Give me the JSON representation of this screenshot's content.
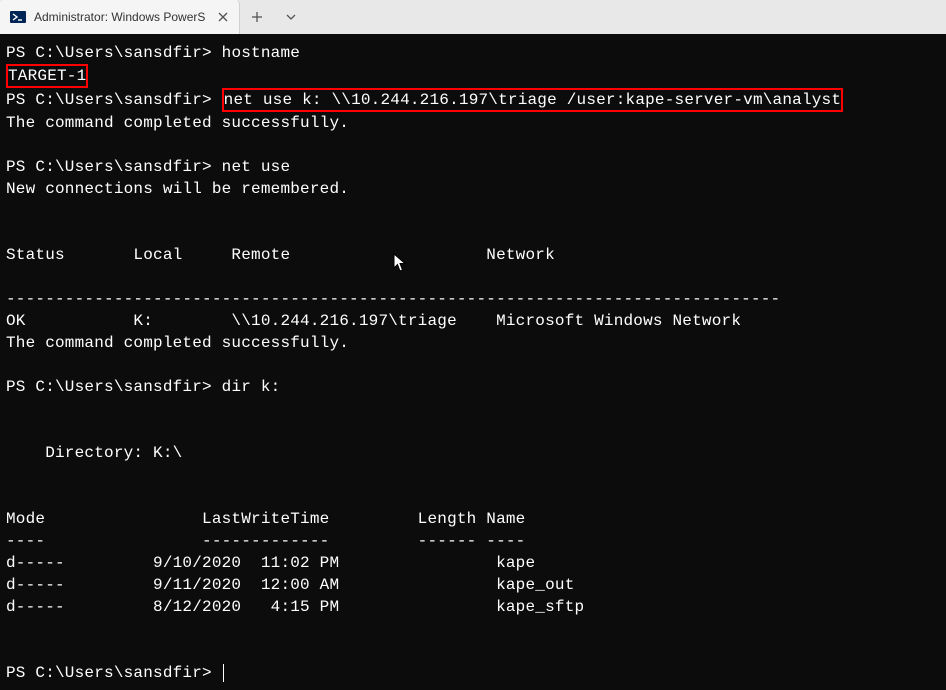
{
  "titlebar": {
    "tab_title": "Administrator: Windows PowerS"
  },
  "prompt": "PS C:\\Users\\sansdfir>",
  "cmds": {
    "hostname": "hostname",
    "netuse_full": "net use k: \\\\10.244.216.197\\triage /user:kape-server-vm\\analyst",
    "netuse_list": "net use",
    "dirk": "dir k:"
  },
  "out": {
    "hostname_result": "TARGET-1",
    "success": "The command completed successfully.",
    "newconn": "New connections will be remembered.",
    "table_header": "Status       Local     Remote                    Network",
    "table_rule": "-------------------------------------------------------------------------------",
    "table_row": "OK           K:        \\\\10.244.216.197\\triage    Microsoft Windows Network",
    "dir_header": "    Directory: K:\\",
    "listing_header": "Mode                LastWriteTime         Length Name",
    "listing_rule": "----                -------------         ------ ----",
    "rows": [
      "d-----         9/10/2020  11:02 PM                kape",
      "d-----         9/11/2020  12:00 AM                kape_out",
      "d-----         8/12/2020   4:15 PM                kape_sftp"
    ]
  }
}
